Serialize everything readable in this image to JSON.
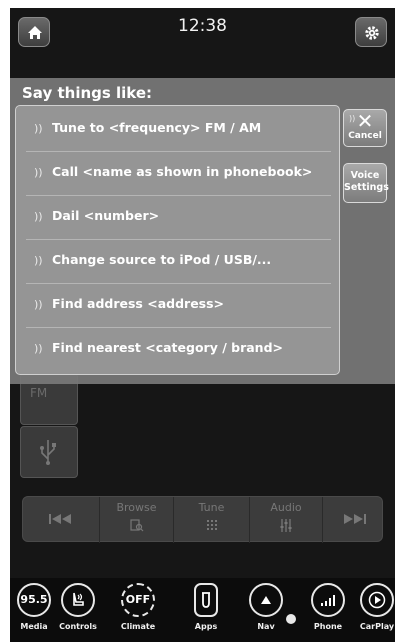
{
  "status_bar": {
    "time": "12:38"
  },
  "voice_prompt": {
    "title": "Say things like:",
    "commands": [
      "Tune to <frequency> FM / AM",
      "Call <name as shown in phonebook>",
      "Dail <number>",
      "Change source to iPod / USB/...",
      "Find address <address>",
      "Find nearest <category / brand>"
    ],
    "cancel_label": "Cancel",
    "voice_settings_line1": "Voice",
    "voice_settings_line2": "Settings"
  },
  "background_radio": {
    "band_label": "FM",
    "controls": {
      "browse": "Browse",
      "tune": "Tune",
      "audio": "Audio"
    }
  },
  "bottom_nav": {
    "media": {
      "label": "Media",
      "value": "95.5"
    },
    "controls": {
      "label": "Controls"
    },
    "climate": {
      "label": "Climate",
      "value": "OFF"
    },
    "apps": {
      "label": "Apps"
    },
    "nav": {
      "label": "Nav"
    },
    "phone": {
      "label": "Phone"
    },
    "carplay": {
      "label": "CarPlay"
    }
  },
  "icons": {
    "home": "home-icon",
    "settings": "gear-icon",
    "voice": "voice-wave-icon",
    "usb": "usb-icon",
    "previous": "previous-track-icon",
    "next": "next-track-icon",
    "seat": "seat-controls-icon",
    "apps": "phone-app-icon",
    "nav": "navigation-arrow-icon",
    "phone": "signal-bars-icon",
    "carplay": "play-icon",
    "bluetooth": "bluetooth-icon"
  }
}
